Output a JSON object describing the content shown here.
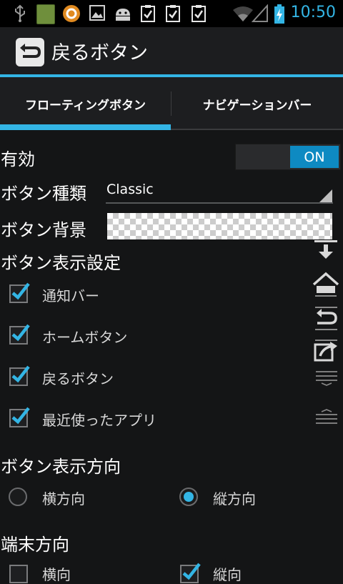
{
  "status_bar": {
    "time": "10:50"
  },
  "action_bar": {
    "title": "戻るボタン"
  },
  "tabs": [
    {
      "label": "フローティングボタン"
    },
    {
      "label": "ナビゲーションバー"
    }
  ],
  "settings": {
    "enabled_label": "有効",
    "enabled_toggle": "ON",
    "button_type_label": "ボタン種類",
    "button_type_value": "Classic",
    "button_bg_label": "ボタン背景",
    "display_settings_label": "ボタン表示設定",
    "display_items": [
      {
        "label": "通知バー"
      },
      {
        "label": "ホームボタン"
      },
      {
        "label": "戻るボタン"
      },
      {
        "label": "最近使ったアプリ"
      }
    ],
    "direction_label": "ボタン表示方向",
    "direction_options": [
      {
        "label": "横方向"
      },
      {
        "label": "縦方向"
      }
    ],
    "device_orientation_label": "端末方向",
    "device_orientation_options": [
      {
        "label": "横向"
      },
      {
        "label": "縦向"
      }
    ]
  },
  "colors": {
    "accent": "#33b5e5",
    "toggle_on": "#0e8ac2"
  }
}
